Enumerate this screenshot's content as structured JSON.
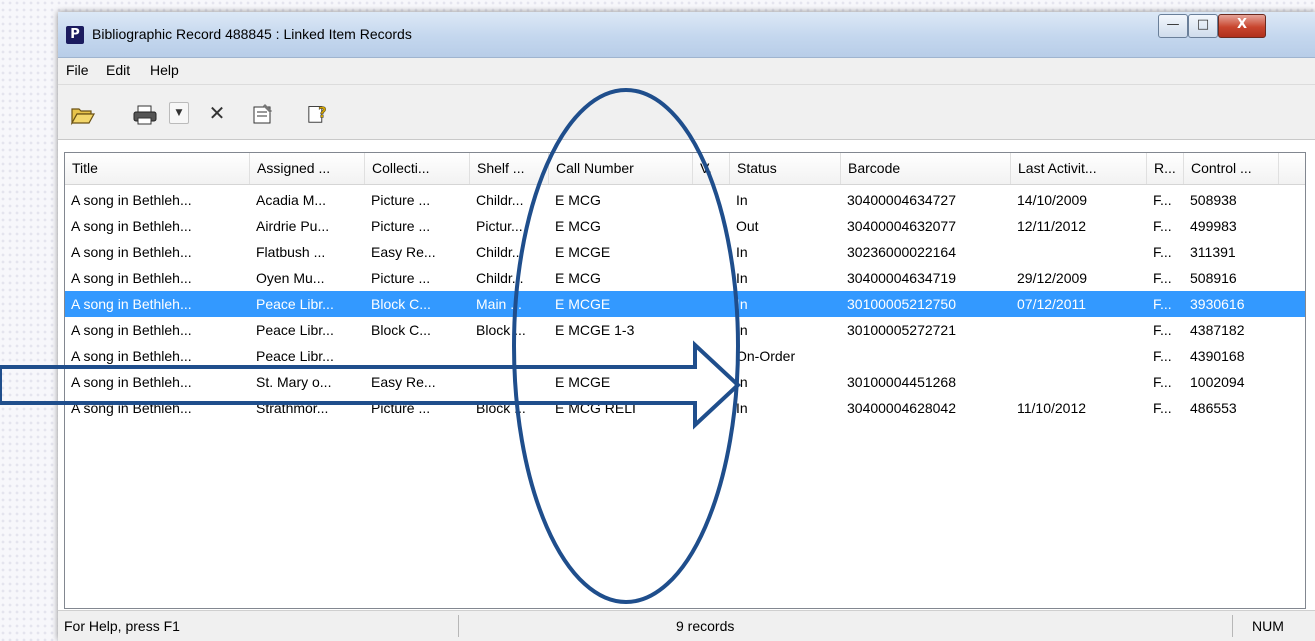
{
  "window": {
    "app_logo": "P",
    "title": "Bibliographic Record 488845 : Linked Item Records",
    "controls": {
      "minimize": "—",
      "maximize": "□",
      "close": "X"
    }
  },
  "menu": [
    "File",
    "Edit",
    "Help"
  ],
  "toolbar": {
    "icons": [
      "open-folder-icon",
      "print-icon",
      "dropdown-arrow-icon",
      "delete-icon",
      "properties-icon",
      "help-icon"
    ]
  },
  "list": {
    "columns": [
      "Title",
      "Assigned ...",
      "Collecti...",
      "Shelf ...",
      "Call Number",
      "V.",
      "Status",
      "Barcode",
      "Last Activit...",
      "R...",
      "Control ..."
    ],
    "rows": [
      [
        "A song in Bethleh...",
        "Acadia M...",
        "Picture ...",
        "Childr...",
        "E MCG",
        "",
        "In",
        "30400004634727",
        "14/10/2009",
        "F...",
        "508938"
      ],
      [
        "A song in Bethleh...",
        "Airdrie Pu...",
        "Picture ...",
        "Pictur...",
        "E MCG",
        "",
        "Out",
        "30400004632077",
        "12/11/2012",
        "F...",
        "499983"
      ],
      [
        "A song in Bethleh...",
        "Flatbush ...",
        "Easy Re...",
        "Childr...",
        "E MCGE",
        "",
        "In",
        "30236000022164",
        "",
        "F...",
        "311391"
      ],
      [
        "A song in Bethleh...",
        "Oyen Mu...",
        "Picture ...",
        "Childr...",
        "E MCG",
        "",
        "In",
        "30400004634719",
        "29/12/2009",
        "F...",
        "508916"
      ],
      [
        "A song in Bethleh...",
        "Peace Libr...",
        "Block C...",
        "Main ...",
        "E MCGE",
        "",
        "In",
        "30100005212750",
        "07/12/2011",
        "F...",
        "3930616"
      ],
      [
        "A song in Bethleh...",
        "Peace Libr...",
        "Block C...",
        "Block ...",
        "E MCGE 1-3",
        "",
        "In",
        "30100005272721",
        "",
        "F...",
        "4387182"
      ],
      [
        "A song in Bethleh...",
        "Peace Libr...",
        "",
        "",
        "",
        "",
        "On-Order",
        "",
        "",
        "F...",
        "4390168"
      ],
      [
        "A song in Bethleh...",
        "St. Mary o...",
        "Easy Re...",
        "",
        "E MCGE",
        "",
        "In",
        "30100004451268",
        "",
        "F...",
        "1002094"
      ],
      [
        "A song in Bethleh...",
        "Strathmor...",
        "Picture ...",
        "Block ...",
        "E MCG RELI",
        "",
        "In",
        "30400004628042",
        "11/10/2012",
        "F...",
        "486553"
      ]
    ],
    "selected_row": 4
  },
  "statusbar": {
    "help": "For Help, press F1",
    "records": "9 records",
    "num": "NUM"
  },
  "annotations": {
    "color": "#1f4e8c"
  }
}
